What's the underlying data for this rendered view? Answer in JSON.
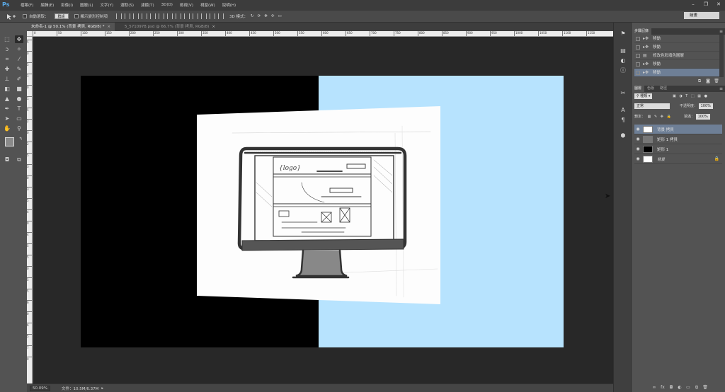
{
  "app": {
    "logo": "Ps"
  },
  "menu": [
    "檔案(F)",
    "編輯(E)",
    "影像(I)",
    "圖層(L)",
    "文字(Y)",
    "選取(S)",
    "濾鏡(T)",
    "3D(D)",
    "檢視(V)",
    "視窗(W)",
    "說明(H)"
  ],
  "window_controls": {
    "minimize": "–",
    "restore": "❐",
    "close": "✕"
  },
  "options": {
    "auto_select_label": "自動選取：",
    "auto_select_value": "群組",
    "transform_controls_label": "顯示變形控制項",
    "mode_3d_label": "3D 模式：",
    "workspace": "繪畫"
  },
  "tabs": [
    {
      "label": "未命名-1 @ 50.1% (背景 拷貝, RGB/8) *",
      "close": "×"
    },
    {
      "label": "5_5710978.psd @ 66.7% (背景 拷貝, RGB/8)",
      "close": "×"
    }
  ],
  "ruler": {
    "top": [
      "0",
      "50",
      "100",
      "150",
      "200",
      "250",
      "300",
      "350",
      "400",
      "450",
      "500",
      "550",
      "600",
      "650",
      "700",
      "750",
      "800",
      "850",
      "900",
      "950",
      "1000",
      "1050",
      "1100",
      "1150"
    ],
    "left": [
      "5",
      "0",
      "5",
      "1",
      "0",
      "1",
      "5",
      "2",
      "0",
      "2",
      "5",
      "3",
      "0",
      "3",
      "5",
      "4",
      "0",
      "4",
      "5",
      "5",
      "0",
      "5",
      "5",
      "6",
      "0",
      "6",
      "5",
      "7",
      "0"
    ]
  },
  "status": {
    "zoom": "50.09%",
    "doc_info": "文件：10.5M/6.37M"
  },
  "history": {
    "tabs": [
      "步驟記錄"
    ],
    "items": [
      {
        "label": "移動",
        "icon": "move-step-icon",
        "selected": false
      },
      {
        "label": "移動",
        "icon": "move-step-icon",
        "selected": false
      },
      {
        "label": "修改色彩填色圖層",
        "icon": "fill-layer-icon",
        "selected": false
      },
      {
        "label": "移動",
        "icon": "move-step-icon",
        "selected": false
      },
      {
        "label": "移動",
        "icon": "move-step-icon",
        "selected": true
      }
    ]
  },
  "layers_panel": {
    "tabs": [
      "圖層",
      "色版",
      "路徑"
    ],
    "kind_filter": "種類",
    "blend_mode": "正常",
    "opacity_label": "不透明度：",
    "opacity_value": "100%",
    "lock_label": "鎖定：",
    "fill_label": "填滿：",
    "fill_value": "100%",
    "layers": [
      {
        "name": "背景 拷貝",
        "selected": true,
        "thumb": "#ffffff",
        "locked": false
      },
      {
        "name": "矩形 1 拷貝",
        "selected": false,
        "thumb": "#7a7a7a",
        "locked": false
      },
      {
        "name": "矩形 1",
        "selected": false,
        "thumb": "#000000",
        "locked": false
      },
      {
        "name": "背景",
        "selected": false,
        "thumb": "#ffffff",
        "locked": true
      }
    ]
  },
  "colors": {
    "canvas_left": "#000000",
    "canvas_right": "#b7e3fe",
    "selection": "#6e7f96"
  }
}
